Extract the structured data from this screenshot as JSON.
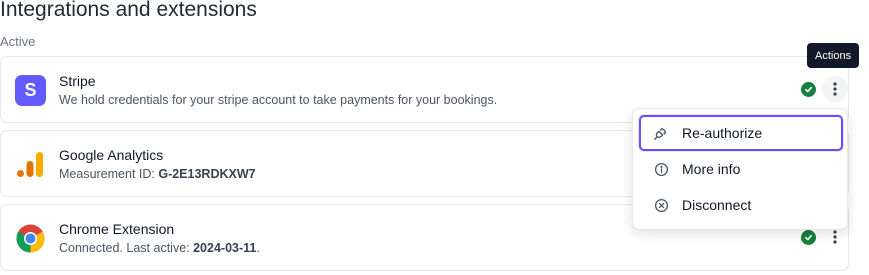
{
  "page": {
    "title": "Integrations and extensions",
    "section_label": "Active"
  },
  "integrations": [
    {
      "name": "Stripe",
      "description": "We hold credentials for your stripe account to take payments for your bookings.",
      "logo_letter": "S",
      "logo_icon": "stripe-logo",
      "status_icon": "check-circle-icon"
    },
    {
      "name": "Google Analytics",
      "description_prefix": "Measurement ID: ",
      "description_value": "G-2E13RDKXW7",
      "logo_icon": "google-analytics-logo"
    },
    {
      "name": "Chrome Extension",
      "description_prefix": "Connected. Last active: ",
      "description_value": "2024-03-11",
      "description_suffix": ".",
      "logo_icon": "chrome-logo",
      "status_icon": "check-circle-icon"
    }
  ],
  "tooltip": {
    "text": "Actions"
  },
  "actions_menu": {
    "items": [
      {
        "label": "Re-authorize",
        "icon": "plug-icon",
        "focused": true
      },
      {
        "label": "More info",
        "icon": "info-circle-icon"
      },
      {
        "label": "Disconnect",
        "icon": "x-circle-icon"
      }
    ]
  },
  "colors": {
    "stripe_brand": "#635bff",
    "success": "#15803d",
    "focus_ring": "#6d4aff",
    "ga_orange": "#f9ab00",
    "ga_dark_orange": "#e37400"
  }
}
